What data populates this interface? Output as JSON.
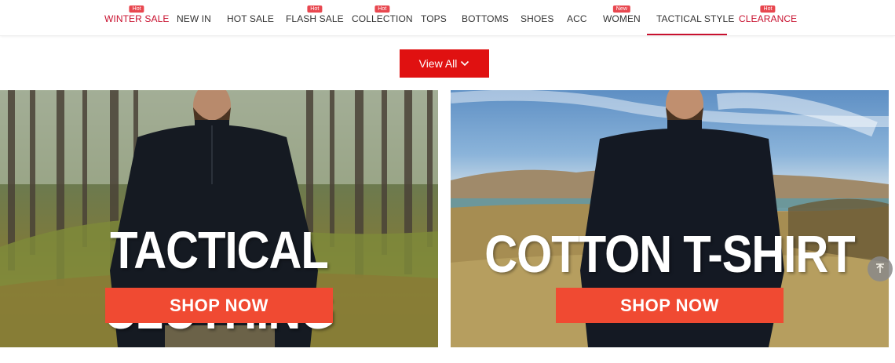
{
  "nav": {
    "items": [
      {
        "label": "WINTER SALE",
        "badge": "Hot",
        "red": true
      },
      {
        "label": "NEW IN",
        "badge": "",
        "red": false
      },
      {
        "label": "HOT SALE",
        "badge": "",
        "red": false
      },
      {
        "label": "FLASH SALE",
        "badge": "Hot",
        "red": false
      },
      {
        "label": "COLLECTION",
        "badge": "Hot",
        "red": false
      },
      {
        "label": "TOPS",
        "badge": "",
        "red": false
      },
      {
        "label": "BOTTOMS",
        "badge": "",
        "red": false
      },
      {
        "label": "SHOES",
        "badge": "",
        "red": false
      },
      {
        "label": "ACC",
        "badge": "",
        "red": false
      },
      {
        "label": "WOMEN",
        "badge": "New",
        "red": false
      },
      {
        "label": "TACTICAL STYLE",
        "badge": "",
        "red": false,
        "active": true
      },
      {
        "label": "CLEARANCE",
        "badge": "Hot",
        "red": true
      }
    ]
  },
  "view_all": {
    "label": "View All"
  },
  "banners": [
    {
      "title": "TACTICAL CLOTHING",
      "cta": "SHOP NOW"
    },
    {
      "title": "COTTON T-SHIRT",
      "cta": "SHOP NOW"
    }
  ],
  "colors": {
    "accent": "#c8102e",
    "button_red": "#e01111",
    "cta_orange": "#f04a32",
    "badge": "#e8474f"
  },
  "icons": {
    "view_all": "chevron-down-icon",
    "scroll_top": "arrow-up-icon"
  }
}
